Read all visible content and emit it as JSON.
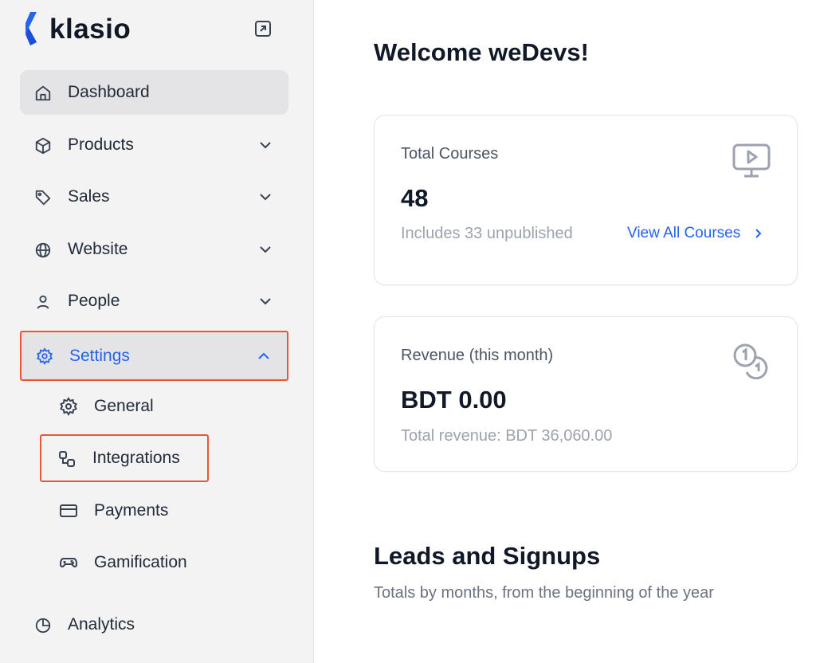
{
  "app": {
    "logo_text": "klasio",
    "brand_color": "#2563eb"
  },
  "sidebar": {
    "items": [
      {
        "label": "Dashboard",
        "icon": "home-icon"
      },
      {
        "label": "Products",
        "icon": "box-icon"
      },
      {
        "label": "Sales",
        "icon": "tag-icon"
      },
      {
        "label": "Website",
        "icon": "globe-icon"
      },
      {
        "label": "People",
        "icon": "user-icon"
      },
      {
        "label": "Settings",
        "icon": "gear-icon"
      },
      {
        "label": "Analytics",
        "icon": "pie-chart-icon"
      }
    ],
    "settings_sub": [
      {
        "label": "General",
        "icon": "gear-icon"
      },
      {
        "label": "Integrations",
        "icon": "integrations-icon"
      },
      {
        "label": "Payments",
        "icon": "credit-card-icon"
      },
      {
        "label": "Gamification",
        "icon": "gamepad-icon"
      }
    ]
  },
  "main": {
    "welcome": "Welcome weDevs!",
    "courses_card": {
      "title": "Total Courses",
      "value": "48",
      "sub": "Includes 33 unpublished",
      "link": "View All Courses"
    },
    "revenue_card": {
      "title": "Revenue (this month)",
      "value": "BDT 0.00",
      "sub": "Total revenue: BDT 36,060.00"
    },
    "leads": {
      "title": "Leads and Signups",
      "subtitle": "Totals by months, from the beginning of the year"
    }
  }
}
